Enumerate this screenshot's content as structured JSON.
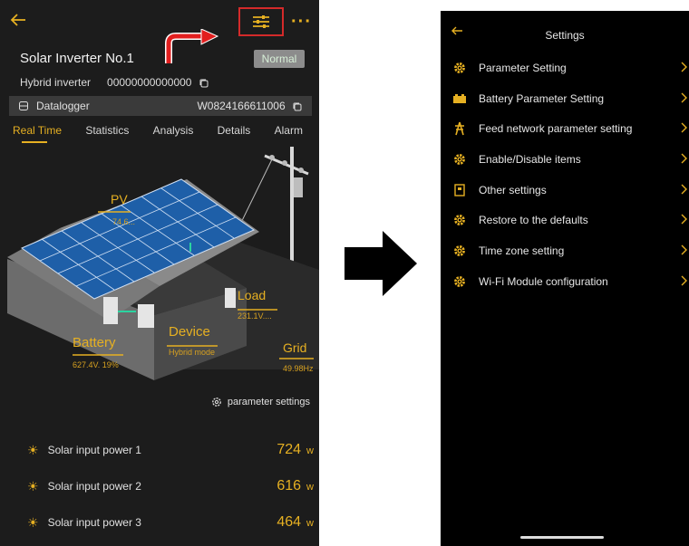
{
  "left": {
    "title": "Solar Inverter No.1",
    "status": "Normal",
    "type_label": "Hybrid inverter",
    "serial": "00000000000000",
    "datalogger_label": "Datalogger",
    "datalogger_id": "W0824166611006",
    "tabs": [
      "Real Time",
      "Statistics",
      "Analysis",
      "Details",
      "Alarm"
    ],
    "scene": {
      "pv_label": "PV",
      "pv_value": "74.6...",
      "battery_label": "Battery",
      "battery_value": "627.4V. 19%",
      "device_label": "Device",
      "device_value": "Hybrid mode",
      "load_label": "Load",
      "load_value": "231.1V....",
      "grid_label": "Grid",
      "grid_value": "49.98Hz"
    },
    "param_settings": "parameter settings",
    "power_rows": [
      {
        "label": "Solar input power 1",
        "value": "724",
        "unit": "w"
      },
      {
        "label": "Solar input power 2",
        "value": "616",
        "unit": "w"
      },
      {
        "label": "Solar input power 3",
        "value": "464",
        "unit": "w"
      }
    ]
  },
  "right": {
    "title": "Settings",
    "items": [
      {
        "label": "Parameter Setting",
        "icon": "gear-icon"
      },
      {
        "label": "Battery Parameter Setting",
        "icon": "battery-icon"
      },
      {
        "label": "Feed network parameter setting",
        "icon": "power-tower-icon"
      },
      {
        "label": "Enable/Disable items",
        "icon": "gear-icon"
      },
      {
        "label": "Other settings",
        "icon": "document-icon"
      },
      {
        "label": "Restore to the defaults",
        "icon": "gear-icon"
      },
      {
        "label": "Time zone setting",
        "icon": "gear-icon"
      },
      {
        "label": "Wi-Fi Module configuration",
        "icon": "gear-icon"
      }
    ]
  },
  "colors": {
    "accent": "#e6b022",
    "highlight_border": "#d42a2a"
  }
}
